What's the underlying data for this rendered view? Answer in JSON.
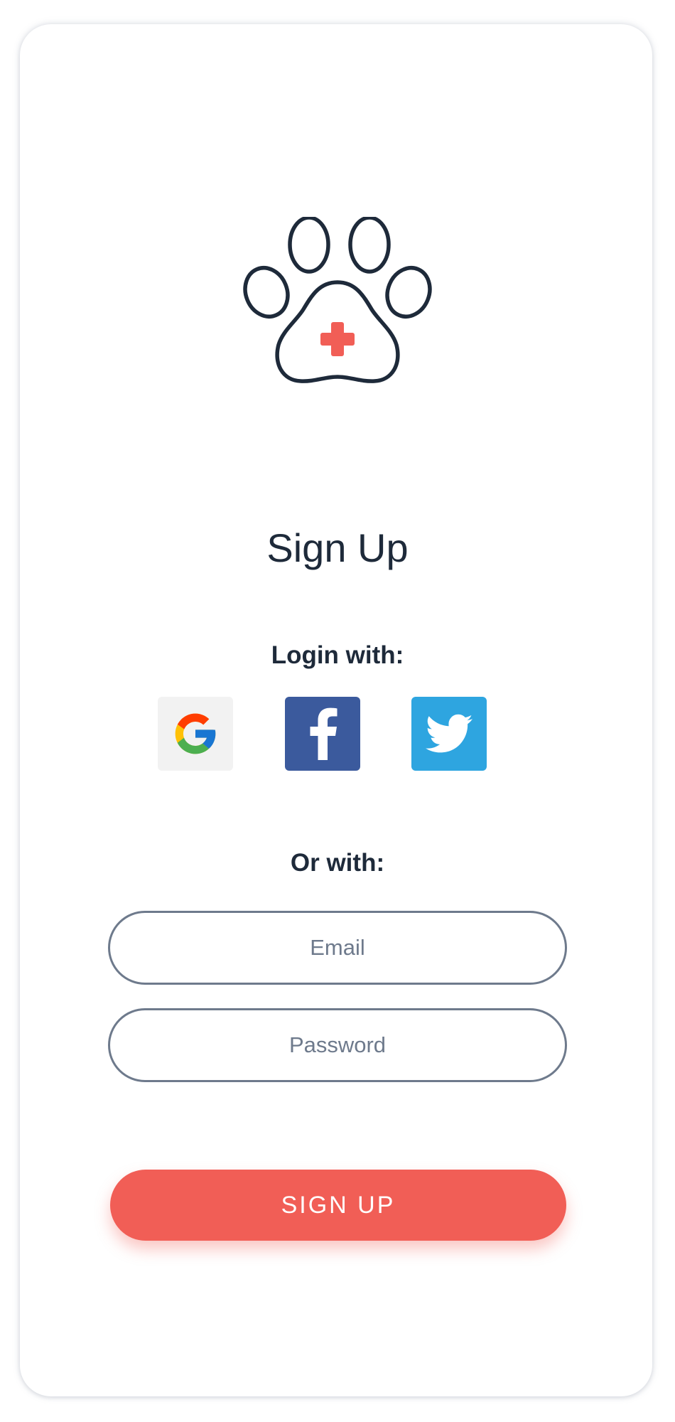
{
  "page": {
    "title": "Sign Up"
  },
  "social": {
    "heading": "Login with:",
    "providers": [
      {
        "name": "Google",
        "icon": "google-icon",
        "bg": "#f2f2f2"
      },
      {
        "name": "Facebook",
        "icon": "facebook-icon",
        "bg": "#3b5a9d"
      },
      {
        "name": "Twitter",
        "icon": "twitter-icon",
        "bg": "#2ea5e0"
      }
    ]
  },
  "form": {
    "heading": "Or with:",
    "email_placeholder": "Email",
    "password_placeholder": "Password",
    "submit_label": "SIGN UP"
  },
  "colors": {
    "accent": "#f15e56",
    "text_dark": "#1e2a3a",
    "field_border": "#6e7a8c"
  },
  "icons": {
    "logo": "paw-medical-cross-icon"
  }
}
